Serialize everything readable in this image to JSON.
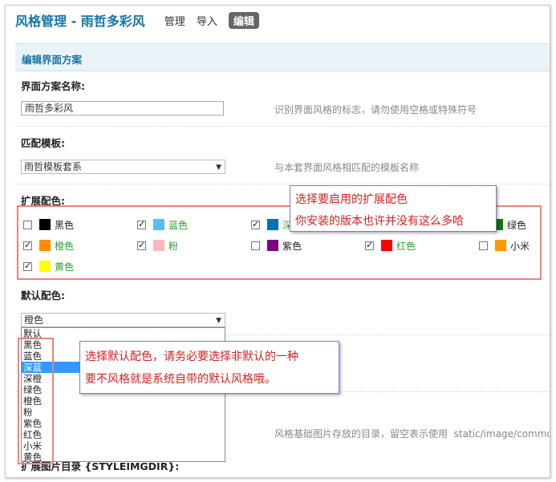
{
  "header": {
    "title": "风格管理 - 雨哲多彩风",
    "nav": [
      "管理",
      "导入",
      "编辑"
    ]
  },
  "section": {
    "title": "编辑界面方案"
  },
  "form": {
    "scheme_name_label": "界面方案名称:",
    "scheme_name_value": "雨哲多彩风",
    "scheme_name_hint": "识别界面风格的标志，请勿使用空格或特殊符号",
    "template_label": "匹配模板:",
    "template_value": "雨哲模板套系",
    "template_hint": "与本套界面风格相匹配的模板名称",
    "ext_colors_label": "扩展配色:",
    "default_color_label": "默认配色:",
    "default_color_value": "橙色",
    "imgdir_hint": "风格基础图片存放的目录，留空表示使用",
    "imgdir_path": "static/image/commo",
    "ext_imgdir_label": "扩展图片目录 {STYLEIMGDIR}:"
  },
  "colors": [
    {
      "name": "黑色",
      "hex": "#000000",
      "checked": false
    },
    {
      "name": "蓝色",
      "hex": "#5bbcf0",
      "checked": true
    },
    {
      "name": "深",
      "hex": "#0070c0",
      "checked": true
    },
    {
      "name": "绿色",
      "hex": "#0a7a0a",
      "checked": false
    },
    {
      "name": "橙色",
      "hex": "#ff8c00",
      "checked": true
    },
    {
      "name": "粉",
      "hex": "#ffb6c1",
      "checked": true
    },
    {
      "name": "紫色",
      "hex": "#800080",
      "checked": false
    },
    {
      "name": "红色",
      "hex": "#ff0000",
      "checked": true
    },
    {
      "name": "小米",
      "hex": "#ff9900",
      "checked": false
    },
    {
      "name": "黄色",
      "hex": "#ffff00",
      "checked": true
    }
  ],
  "dropdown_options": [
    "默认",
    "黑色",
    "蓝色",
    "深蓝",
    "深橙",
    "绿色",
    "橙色",
    "粉",
    "紫色",
    "红色",
    "小米",
    "黄色"
  ],
  "dropdown_selected": "深蓝",
  "callouts": {
    "ext_line1": "选择要启用的扩展配色",
    "ext_line2": "你安装的版本也许并没有这么多哈",
    "def_line1": "选择默认配色，请务必要选择非默认的一种",
    "def_line2": "要不风格就是系统自带的默认风格哦。"
  },
  "colors_ui": {
    "annotation_red": "#e8837f",
    "callout_text": "#d62020",
    "accent": "#1874a8",
    "selection": "#3399ff"
  }
}
